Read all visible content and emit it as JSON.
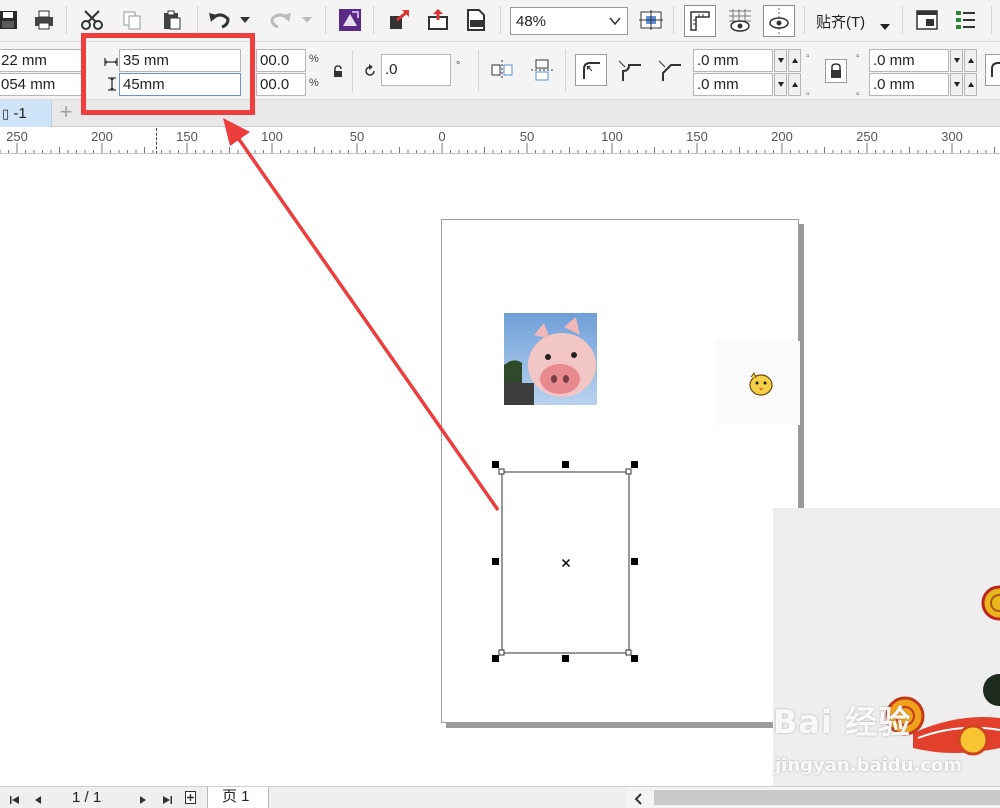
{
  "toolbar": {
    "zoom_value": "48%",
    "snap_label": "贴齐(T)"
  },
  "property_bar": {
    "x_value": "22 mm",
    "y_value": "054 mm",
    "width_value": "35 mm",
    "height_value": "45mm",
    "scale_x": "00.0",
    "scale_y": "00.0",
    "percent_symbol": "%",
    "rotation_value": ".0",
    "degree_symbol": "°",
    "corner_tl": ".0 mm",
    "corner_bl": ".0 mm",
    "corner_tr": ".0 mm",
    "corner_br": ".0 mm"
  },
  "tabs": {
    "document_tab": "-1",
    "add_tab": "+"
  },
  "ruler": {
    "labels": [
      "250",
      "200",
      "150",
      "100",
      "50",
      "0",
      "50",
      "100",
      "150",
      "200",
      "250",
      "300"
    ]
  },
  "status_bar": {
    "page_indicator": "1 / 1",
    "page_tab": "页 1"
  },
  "watermark": {
    "brand": "Bai 经验",
    "url": "jingyan.baidu.com"
  },
  "colors": {
    "highlight": "#ee3d3d",
    "handle": "#000000",
    "doc_tab_bg": "#cfe4f8",
    "toolbar_bg": "#f4f4f4"
  }
}
